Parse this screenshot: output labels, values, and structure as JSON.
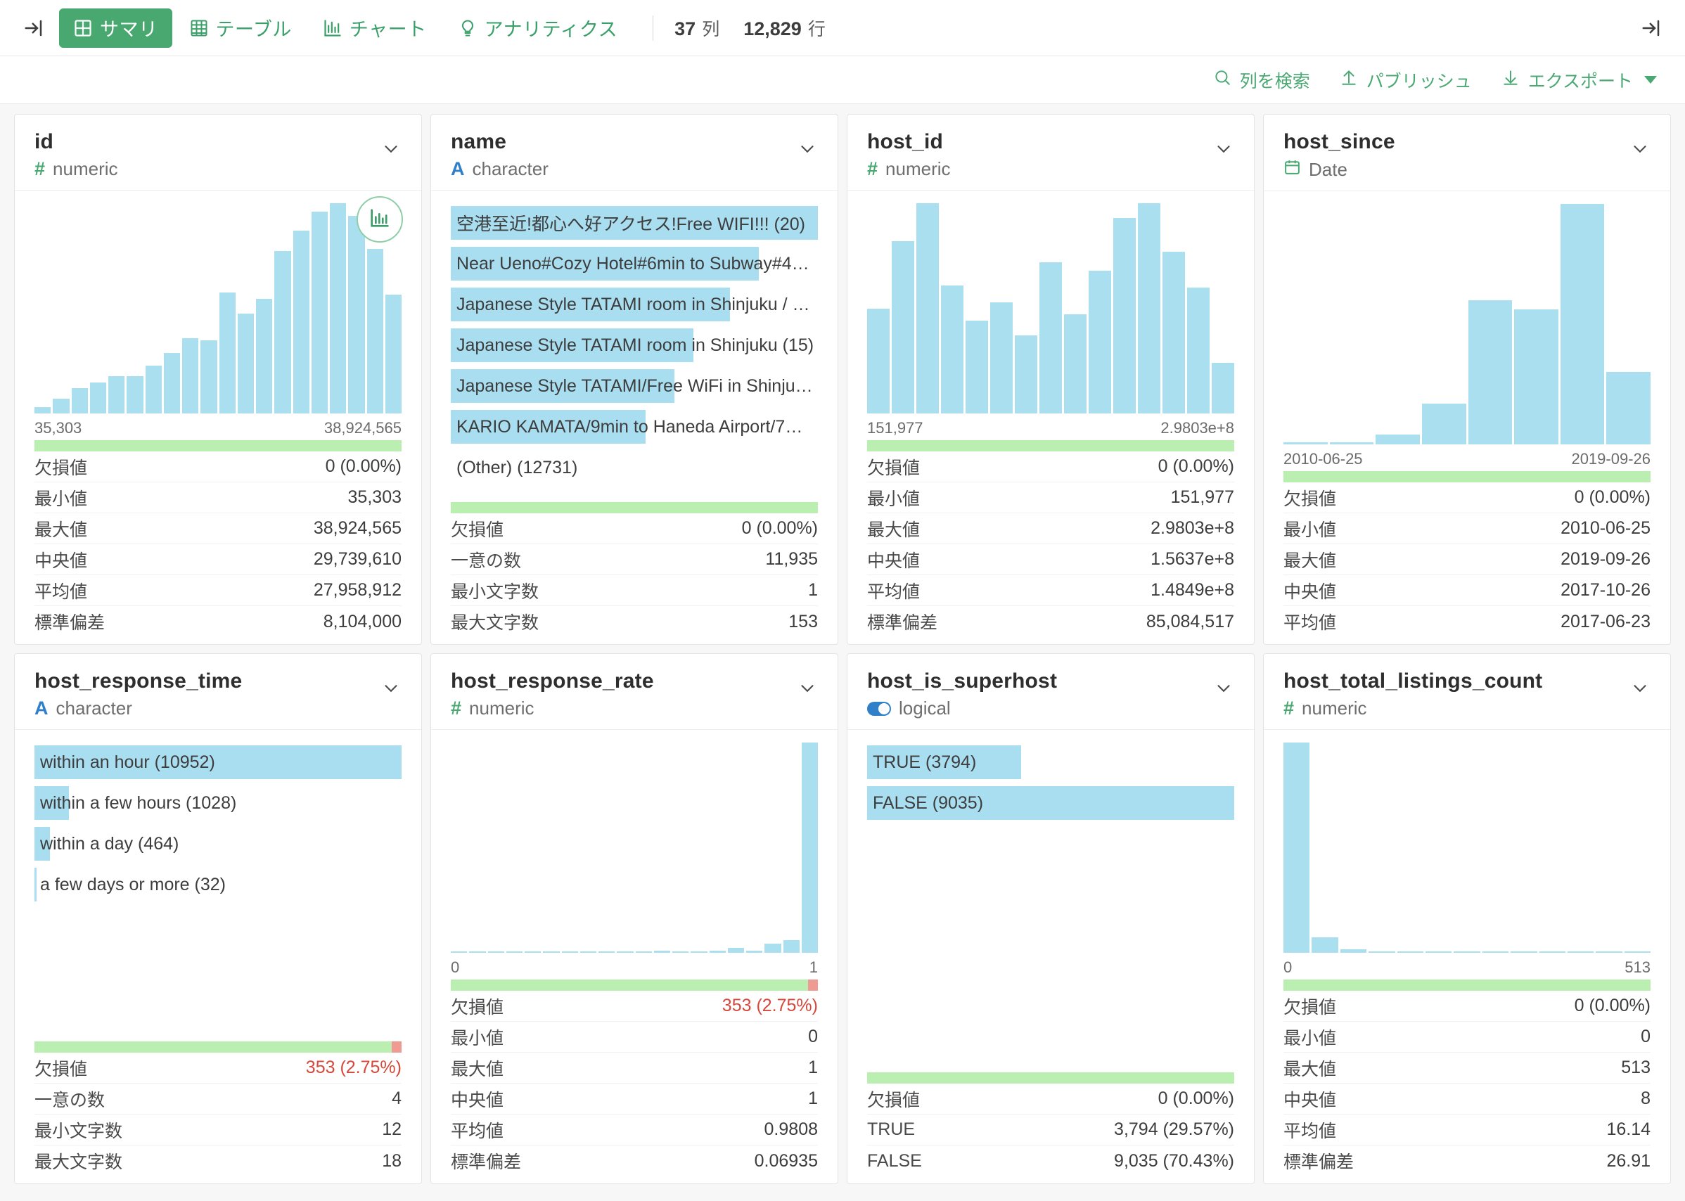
{
  "toolbar": {
    "collapse_icon": "collapse-left-icon",
    "expand_icon": "expand-right-icon",
    "tabs": [
      {
        "label": "サマリ",
        "icon": "grid-summary-icon",
        "active": true
      },
      {
        "label": "テーブル",
        "icon": "table-icon",
        "active": false
      },
      {
        "label": "チャート",
        "icon": "bar-chart-icon",
        "active": false
      },
      {
        "label": "アナリティクス",
        "icon": "lightbulb-icon",
        "active": false
      }
    ],
    "columns_count": "37",
    "columns_unit": "列",
    "rows_count": "12,829",
    "rows_unit": "行"
  },
  "actions": [
    {
      "label": "列を検索",
      "icon": "search-icon"
    },
    {
      "label": "パブリッシュ",
      "icon": "upload-arrow-icon"
    },
    {
      "label": "エクスポート",
      "icon": "download-arrow-icon",
      "has_caret": true
    }
  ],
  "stat_labels": {
    "missing": "欠損値",
    "min": "最小値",
    "max": "最大値",
    "median": "中央値",
    "mean": "平均値",
    "sd": "標準偏差",
    "unique": "一意の数",
    "min_chars": "最小文字数",
    "max_chars": "最大文字数",
    "true": "TRUE",
    "false": "FALSE"
  },
  "colors": {
    "accent_green": "#48a86f",
    "bar_blue": "#aadff0",
    "ok_green": "#bbeeb1",
    "bad_red": "#ef9a92",
    "alert_text": "#d6483b",
    "numeric_type": "#49a86f",
    "character_type": "#2f7fc9"
  },
  "cards": [
    {
      "name": "id",
      "type_label": "numeric",
      "type_glyph": "#",
      "type_kind": "numeric",
      "has_chart_badge": true,
      "chart_data": {
        "type": "bar",
        "title": "id",
        "xlabel": "",
        "ylabel": "",
        "axis_min": "35,303",
        "axis_max": "38,924,565",
        "values": [
          3,
          7,
          12,
          15,
          18,
          18,
          23,
          29,
          36,
          35,
          58,
          48,
          55,
          78,
          88,
          97,
          101,
          95,
          79,
          57
        ],
        "ylim": [
          0,
          101
        ]
      },
      "missing_pct": 0,
      "stats": [
        {
          "key": "missing",
          "value": "0 (0.00%)",
          "alert": false
        },
        {
          "key": "min",
          "value": "35,303",
          "alert": false
        },
        {
          "key": "max",
          "value": "38,924,565",
          "alert": false
        },
        {
          "key": "median",
          "value": "29,739,610",
          "alert": false
        },
        {
          "key": "mean",
          "value": "27,958,912",
          "alert": false
        },
        {
          "key": "sd",
          "value": "8,104,000",
          "alert": false
        }
      ]
    },
    {
      "name": "name",
      "type_label": "character",
      "type_glyph": "A",
      "type_kind": "character",
      "has_chart_badge": false,
      "chart_data": {
        "type": "bar",
        "title": "name",
        "orientation": "horizontal",
        "categories": [
          "空港至近!都心へ好アクセス!Free WIFI!!! (20)",
          "Near Ueno#Cozy Hotel#6min to Subway#40mi…",
          "Japanese Style TATAMI room in Shinjuku / Fre…",
          "Japanese Style TATAMI room in Shinjuku (15)",
          "Japanese Style TATAMI/Free WiFi in Shinjuku …",
          "KARIO KAMATA/9min to Haneda Airport/7min …",
          "(Other) (12731)"
        ],
        "values": [
          20,
          18,
          16,
          15,
          14,
          13,
          12731
        ],
        "bar_pct": [
          100,
          84,
          76,
          66,
          61,
          53,
          0
        ]
      },
      "missing_pct": 0,
      "stats": [
        {
          "key": "missing",
          "value": "0 (0.00%)",
          "alert": false
        },
        {
          "key": "unique",
          "value": "11,935",
          "alert": false
        },
        {
          "key": "min_chars",
          "value": "1",
          "alert": false
        },
        {
          "key": "max_chars",
          "value": "153",
          "alert": false
        }
      ]
    },
    {
      "name": "host_id",
      "type_label": "numeric",
      "type_glyph": "#",
      "type_kind": "numeric",
      "has_chart_badge": false,
      "chart_data": {
        "type": "bar",
        "title": "host_id",
        "axis_min": "151,977",
        "axis_max": "2.9803e+8",
        "values": [
          50,
          82,
          100,
          61,
          44,
          53,
          37,
          72,
          47,
          68,
          93,
          100,
          77,
          60,
          24
        ],
        "ylim": [
          0,
          100
        ]
      },
      "missing_pct": 0,
      "stats": [
        {
          "key": "missing",
          "value": "0 (0.00%)",
          "alert": false
        },
        {
          "key": "min",
          "value": "151,977",
          "alert": false
        },
        {
          "key": "max",
          "value": "2.9803e+8",
          "alert": false
        },
        {
          "key": "median",
          "value": "1.5637e+8",
          "alert": false
        },
        {
          "key": "mean",
          "value": "1.4849e+8",
          "alert": false
        },
        {
          "key": "sd",
          "value": "85,084,517",
          "alert": false
        }
      ]
    },
    {
      "name": "host_since",
      "type_label": "Date",
      "type_glyph": "calendar",
      "type_kind": "date",
      "has_chart_badge": false,
      "chart_data": {
        "type": "bar",
        "title": "host_since",
        "axis_min": "2010-06-25",
        "axis_max": "2019-09-26",
        "values": [
          1,
          1,
          4,
          17,
          60,
          56,
          100,
          30
        ],
        "ylim": [
          0,
          100
        ]
      },
      "missing_pct": 0,
      "stats": [
        {
          "key": "missing",
          "value": "0 (0.00%)",
          "alert": false
        },
        {
          "key": "min",
          "value": "2010-06-25",
          "alert": false
        },
        {
          "key": "max",
          "value": "2019-09-26",
          "alert": false
        },
        {
          "key": "median",
          "value": "2017-10-26",
          "alert": false
        },
        {
          "key": "mean",
          "value": "2017-06-23",
          "alert": false
        }
      ]
    },
    {
      "name": "host_response_time",
      "type_label": "character",
      "type_glyph": "A",
      "type_kind": "character",
      "has_chart_badge": false,
      "chart_data": {
        "type": "bar",
        "title": "host_response_time",
        "orientation": "horizontal",
        "categories": [
          "within an hour (10952)",
          "within a few hours (1028)",
          "within a day (464)",
          "a few days or more (32)"
        ],
        "values": [
          10952,
          1028,
          464,
          32
        ],
        "bar_pct": [
          100,
          9.4,
          4.2,
          0.6
        ]
      },
      "missing_pct": 2.75,
      "stats": [
        {
          "key": "missing",
          "value": "353 (2.75%)",
          "alert": true
        },
        {
          "key": "unique",
          "value": "4",
          "alert": false
        },
        {
          "key": "min_chars",
          "value": "12",
          "alert": false
        },
        {
          "key": "max_chars",
          "value": "18",
          "alert": false
        }
      ]
    },
    {
      "name": "host_response_rate",
      "type_label": "numeric",
      "type_glyph": "#",
      "type_kind": "numeric",
      "has_chart_badge": false,
      "chart_data": {
        "type": "bar",
        "title": "host_response_rate",
        "axis_min": "0",
        "axis_max": "1",
        "values": [
          0.7,
          0.7,
          0.8,
          0.7,
          0.7,
          0.8,
          0.7,
          0.8,
          0.7,
          0.8,
          0.7,
          0.9,
          0.7,
          0.7,
          0.9,
          2.5,
          1.0,
          4.5,
          6.0,
          100
        ],
        "ylim": [
          0,
          100
        ]
      },
      "missing_pct": 2.75,
      "stats": [
        {
          "key": "missing",
          "value": "353 (2.75%)",
          "alert": true
        },
        {
          "key": "min",
          "value": "0",
          "alert": false
        },
        {
          "key": "max",
          "value": "1",
          "alert": false
        },
        {
          "key": "median",
          "value": "1",
          "alert": false
        },
        {
          "key": "mean",
          "value": "0.9808",
          "alert": false
        },
        {
          "key": "sd",
          "value": "0.06935",
          "alert": false
        }
      ]
    },
    {
      "name": "host_is_superhost",
      "type_label": "logical",
      "type_glyph": "toggle",
      "type_kind": "logical",
      "has_chart_badge": false,
      "chart_data": {
        "type": "bar",
        "title": "host_is_superhost",
        "orientation": "horizontal",
        "categories": [
          "TRUE (3794)",
          "FALSE (9035)"
        ],
        "values": [
          3794,
          9035
        ],
        "bar_pct": [
          42,
          100
        ]
      },
      "missing_pct": 0,
      "stats": [
        {
          "key": "missing",
          "value": "0 (0.00%)",
          "alert": false
        },
        {
          "key": "true",
          "value": "3,794 (29.57%)",
          "alert": false
        },
        {
          "key": "false",
          "value": "9,035 (70.43%)",
          "alert": false
        }
      ]
    },
    {
      "name": "host_total_listings_count",
      "type_label": "numeric",
      "type_glyph": "#",
      "type_kind": "numeric",
      "has_chart_badge": false,
      "chart_data": {
        "type": "bar",
        "title": "host_total_listings_count",
        "axis_min": "0",
        "axis_max": "513",
        "values": [
          100,
          7.5,
          1.6,
          0.7,
          0.7,
          0.7,
          0.7,
          0.7,
          0.7,
          0.7,
          0.7,
          0.7,
          0.7
        ],
        "ylim": [
          0,
          100
        ]
      },
      "missing_pct": 0,
      "stats": [
        {
          "key": "missing",
          "value": "0 (0.00%)",
          "alert": false
        },
        {
          "key": "min",
          "value": "0",
          "alert": false
        },
        {
          "key": "max",
          "value": "513",
          "alert": false
        },
        {
          "key": "median",
          "value": "8",
          "alert": false
        },
        {
          "key": "mean",
          "value": "16.14",
          "alert": false
        },
        {
          "key": "sd",
          "value": "26.91",
          "alert": false
        }
      ]
    }
  ]
}
